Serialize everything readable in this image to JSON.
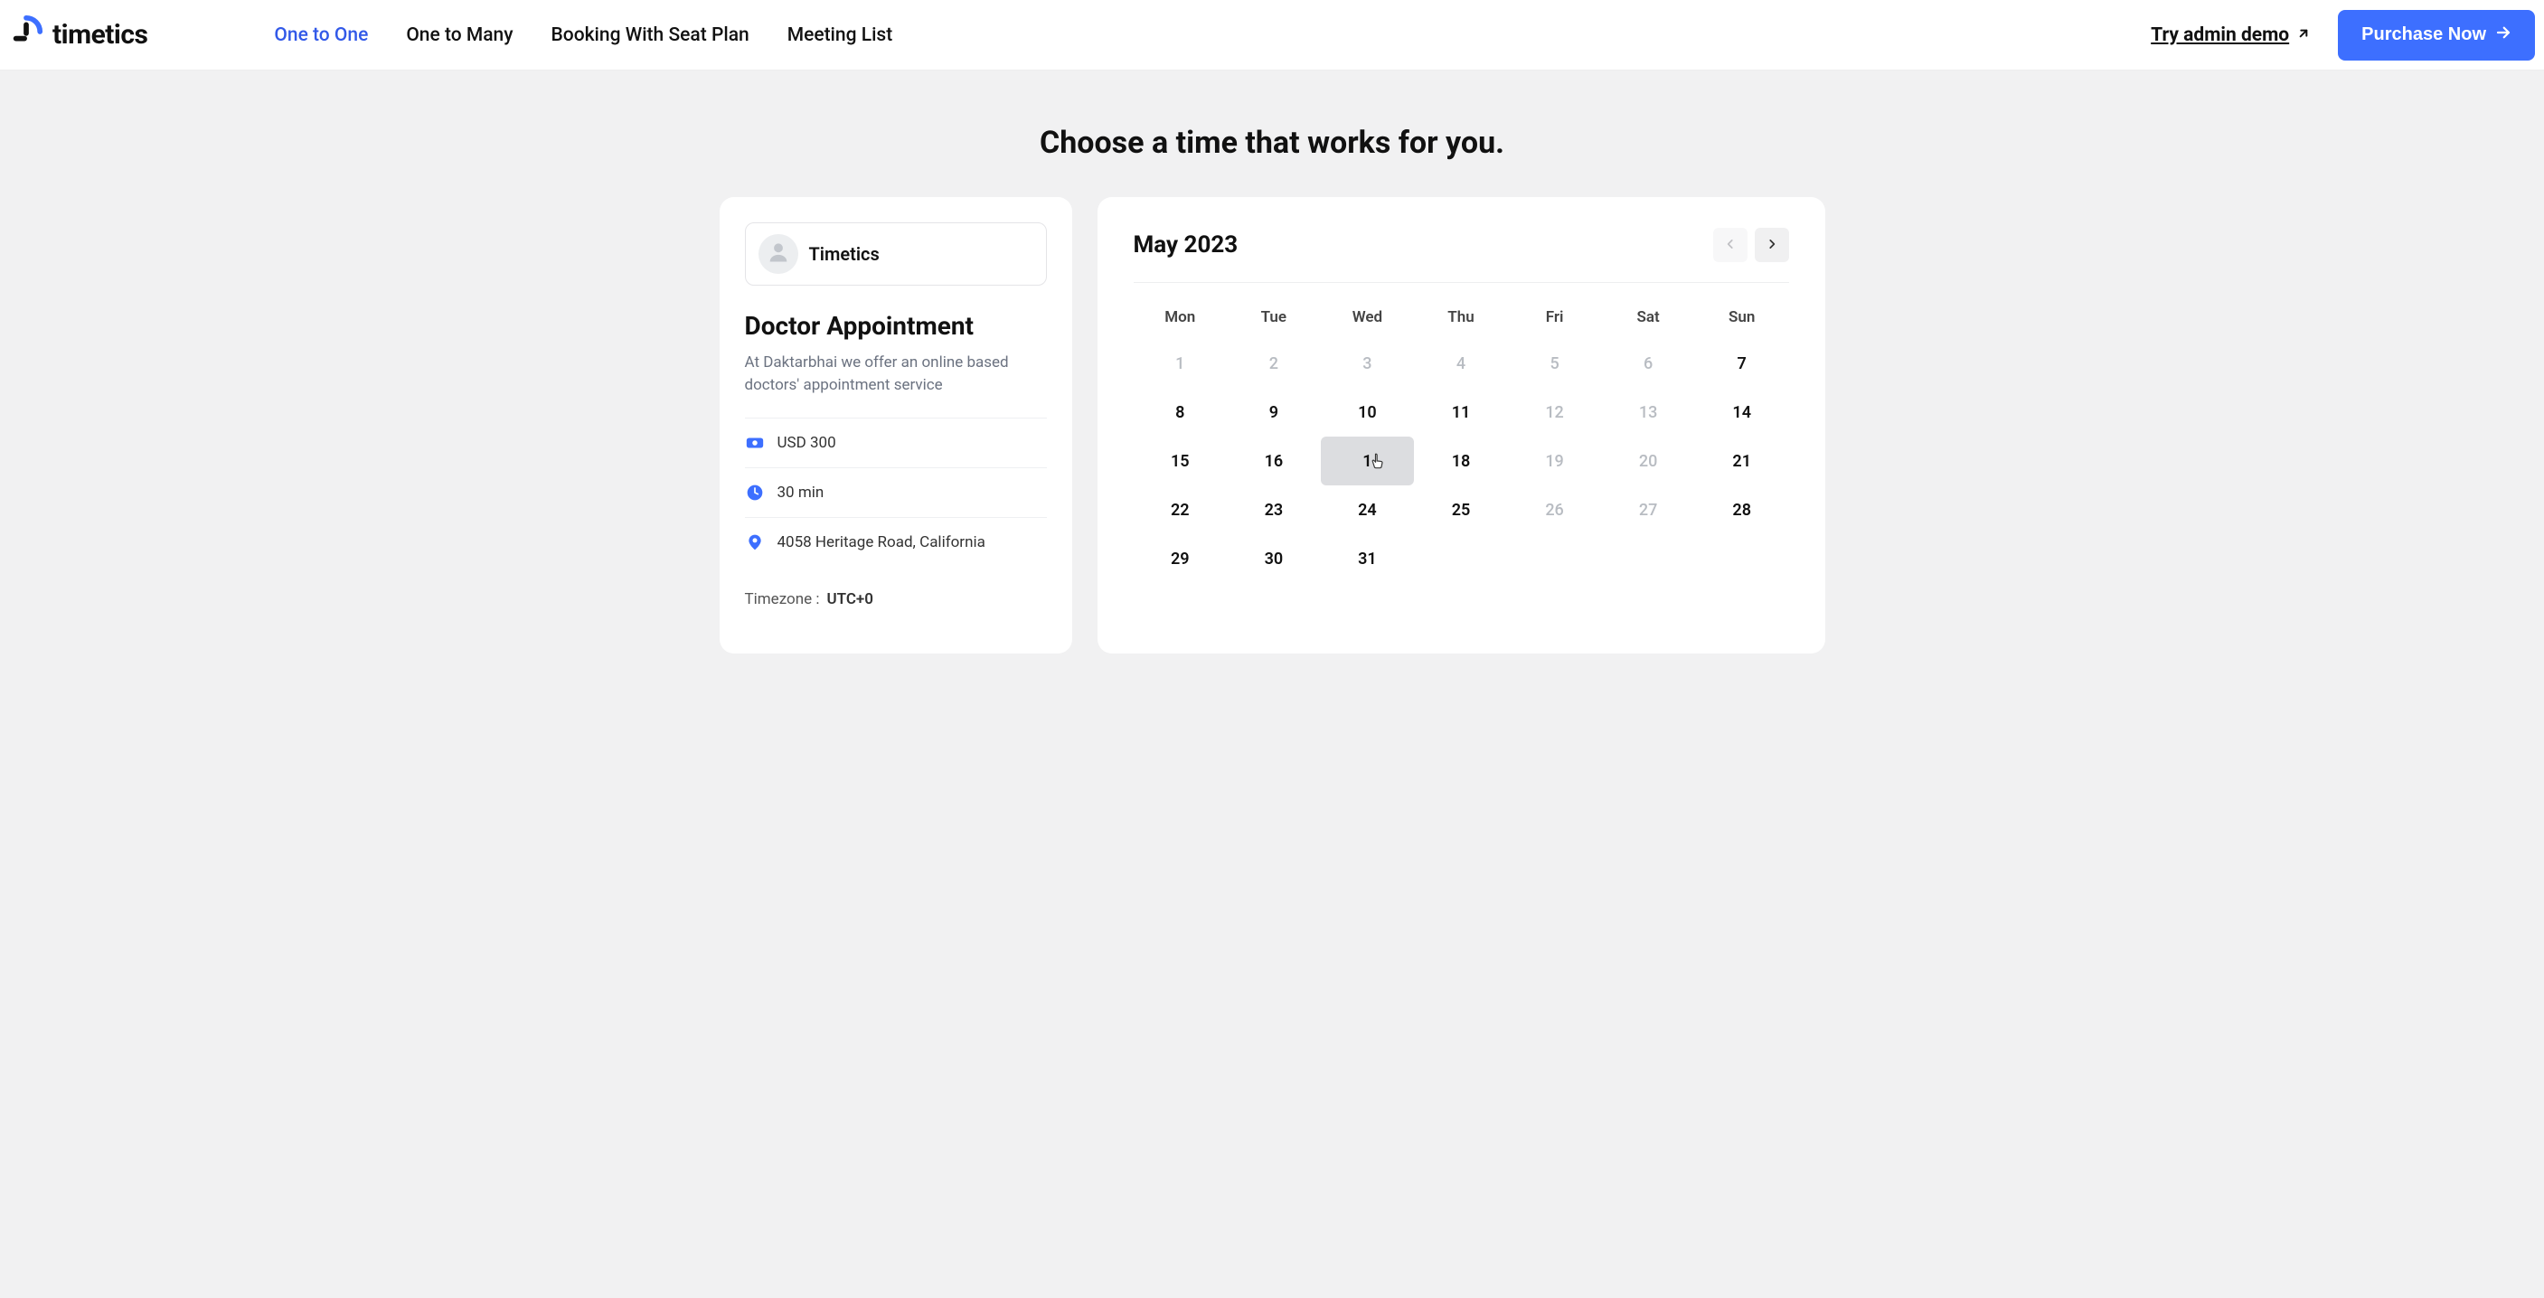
{
  "brand": "timetics",
  "nav": {
    "items": [
      {
        "label": "One to One",
        "active": true
      },
      {
        "label": "One to Many",
        "active": false
      },
      {
        "label": "Booking With Seat Plan",
        "active": false
      },
      {
        "label": "Meeting List",
        "active": false
      }
    ],
    "try_admin": "Try admin demo",
    "purchase": "Purchase Now"
  },
  "page": {
    "heading": "Choose a time that works for you."
  },
  "meeting": {
    "host_name": "Timetics",
    "title": "Doctor Appointment",
    "description": "At Daktarbhai we offer an online based doctors' appointment service",
    "price": "USD 300",
    "duration": "30 min",
    "location": "4058 Heritage Road, California",
    "timezone_label": "Timezone :",
    "timezone_value": "UTC+0"
  },
  "calendar": {
    "month_label": "May 2023",
    "dow": [
      "Mon",
      "Tue",
      "Wed",
      "Thu",
      "Fri",
      "Sat",
      "Sun"
    ],
    "days": [
      {
        "n": "1",
        "muted": true
      },
      {
        "n": "2",
        "muted": true
      },
      {
        "n": "3",
        "muted": true
      },
      {
        "n": "4",
        "muted": true
      },
      {
        "n": "5",
        "muted": true
      },
      {
        "n": "6",
        "muted": true
      },
      {
        "n": "7",
        "muted": false
      },
      {
        "n": "8",
        "muted": false
      },
      {
        "n": "9",
        "muted": false
      },
      {
        "n": "10",
        "muted": false
      },
      {
        "n": "11",
        "muted": false
      },
      {
        "n": "12",
        "muted": true
      },
      {
        "n": "13",
        "muted": true
      },
      {
        "n": "14",
        "muted": false
      },
      {
        "n": "15",
        "muted": false
      },
      {
        "n": "16",
        "muted": false
      },
      {
        "n": "17",
        "muted": false,
        "hovered": true
      },
      {
        "n": "18",
        "muted": false
      },
      {
        "n": "19",
        "muted": true
      },
      {
        "n": "20",
        "muted": true
      },
      {
        "n": "21",
        "muted": false
      },
      {
        "n": "22",
        "muted": false
      },
      {
        "n": "23",
        "muted": false
      },
      {
        "n": "24",
        "muted": false
      },
      {
        "n": "25",
        "muted": false
      },
      {
        "n": "26",
        "muted": true
      },
      {
        "n": "27",
        "muted": true
      },
      {
        "n": "28",
        "muted": false
      },
      {
        "n": "29",
        "muted": false
      },
      {
        "n": "30",
        "muted": false
      },
      {
        "n": "31",
        "muted": false
      }
    ]
  }
}
